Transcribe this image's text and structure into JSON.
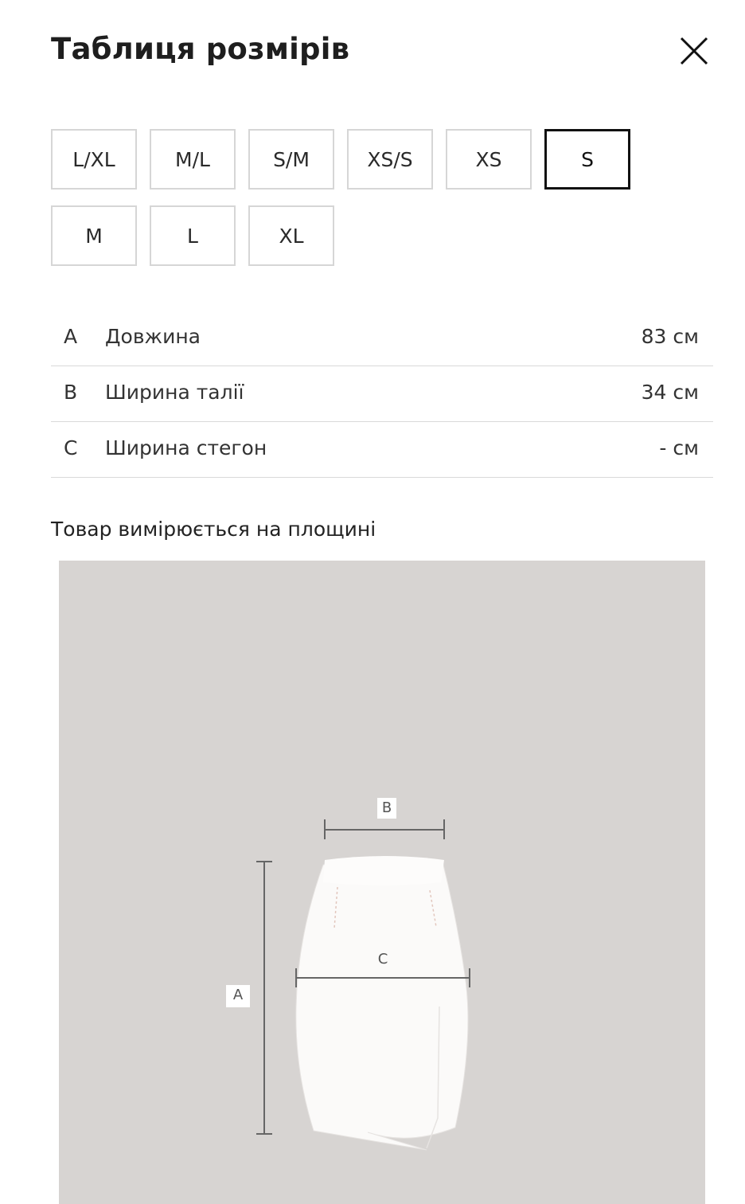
{
  "header": {
    "title": "Таблиця розмірів"
  },
  "icons": {
    "close": "close-icon"
  },
  "sizes": {
    "options": [
      "L/XL",
      "M/L",
      "S/M",
      "XS/S",
      "XS",
      "S",
      "M",
      "L",
      "XL"
    ],
    "selected": "S"
  },
  "measurements": [
    {
      "letter": "A",
      "name": "Довжина",
      "value": "83 см"
    },
    {
      "letter": "B",
      "name": "Ширина талії",
      "value": "34 см"
    },
    {
      "letter": "C",
      "name": "Ширина стегон",
      "value": "- см"
    }
  ],
  "note": "Товар вимірюється на площині",
  "diagram": {
    "label_a": "A",
    "label_b": "B",
    "label_c": "C"
  },
  "colors": {
    "diagram_bg": "#d7d4d2",
    "selected_border": "#111111",
    "border": "#d6d6d6"
  }
}
